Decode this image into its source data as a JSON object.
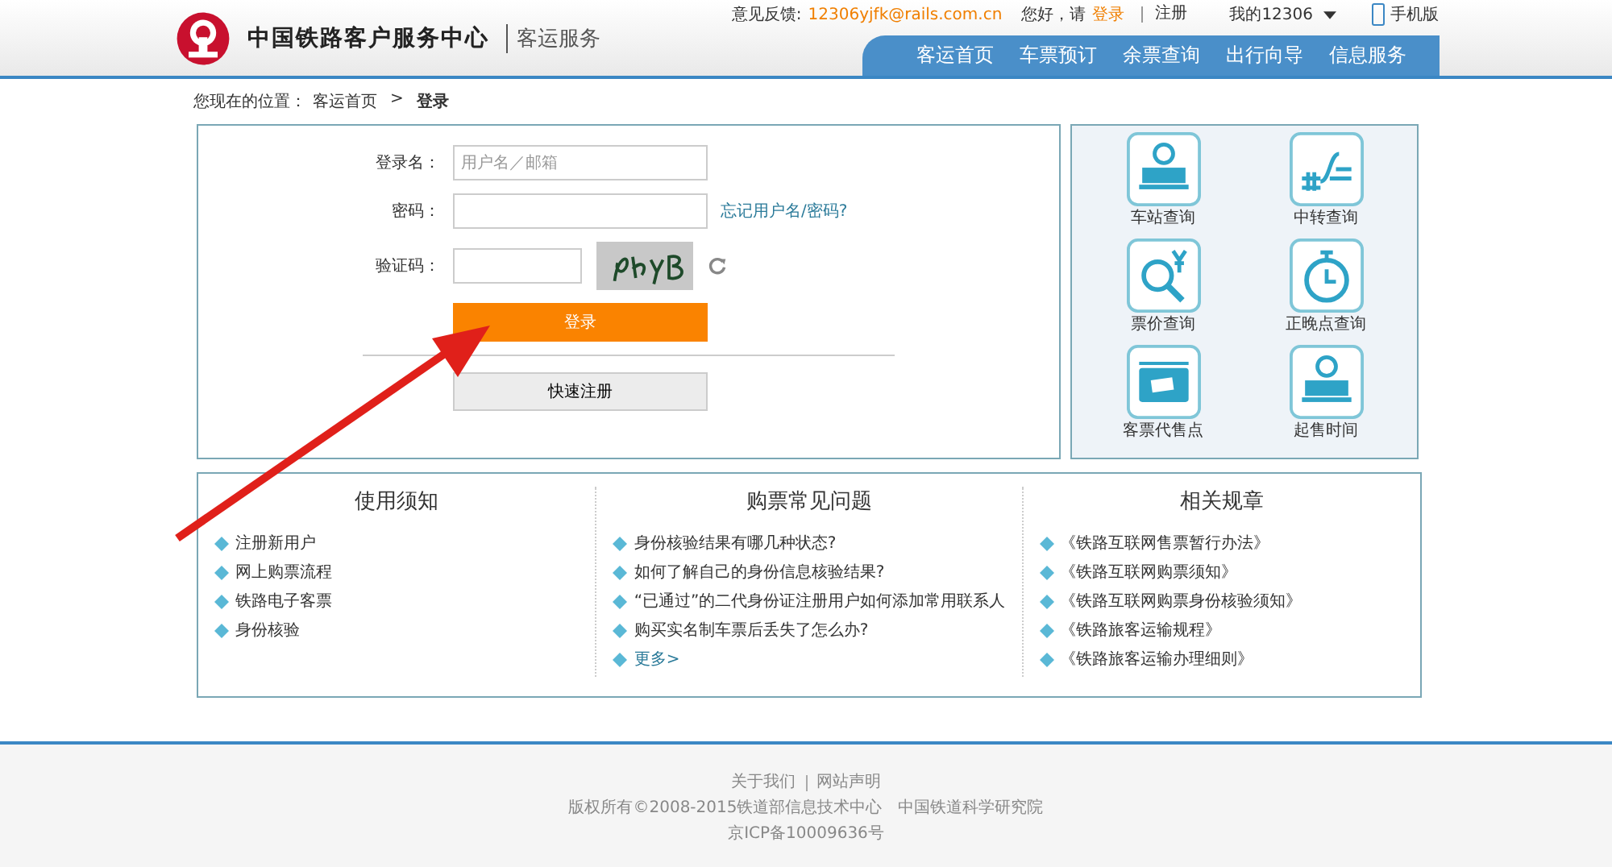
{
  "header": {
    "site_title": "中国铁路客户服务中心",
    "section": "客运服务",
    "feedback_label": "意见反馈:",
    "feedback_email": "12306yjfk@rails.com.cn",
    "greeting": "您好，请",
    "login_link": "登录",
    "register_link": "注册",
    "my_account": "我的12306",
    "mobile": "手机版"
  },
  "nav": [
    {
      "label": "客运首页"
    },
    {
      "label": "车票预订"
    },
    {
      "label": "余票查询"
    },
    {
      "label": "出行向导"
    },
    {
      "label": "信息服务"
    }
  ],
  "breadcrumb": {
    "label": "您现在的位置：",
    "home": "客运首页",
    "separator": ">",
    "current": "登录"
  },
  "login_form": {
    "username_label": "登录名：",
    "username_placeholder": "用户名／邮箱",
    "password_label": "密码：",
    "forgot_link": "忘记用户名/密码?",
    "captcha_label": "验证码：",
    "login_button": "登录",
    "register_button": "快速注册"
  },
  "quick_links": [
    {
      "label": "车站查询",
      "kind": "station"
    },
    {
      "label": "中转查询",
      "kind": "transfer"
    },
    {
      "label": "票价查询",
      "kind": "price"
    },
    {
      "label": "正晚点查询",
      "kind": "clock"
    },
    {
      "label": "客票代售点",
      "kind": "ticket"
    },
    {
      "label": "起售时间",
      "kind": "station"
    }
  ],
  "info_sections": [
    {
      "title": "使用须知",
      "items": [
        "注册新用户",
        "网上购票流程",
        "铁路电子客票",
        "身份核验"
      ]
    },
    {
      "title": "购票常见问题",
      "items": [
        "身份核验结果有哪几种状态?",
        "如何了解自己的身份信息核验结果?",
        "“已通过”的二代身份证注册用户如何添加常用联系人",
        "购买实名制车票后丢失了怎么办?"
      ],
      "more": "更多>"
    },
    {
      "title": "相关规章",
      "items": [
        "《铁路互联网售票暂行办法》",
        "《铁路互联网购票须知》",
        "《铁路互联网购票身份核验须知》",
        "《铁路旅客运输规程》",
        "《铁路旅客运输办理细则》"
      ]
    }
  ],
  "footer": {
    "links": [
      "关于我们",
      "网站声明"
    ],
    "copyright": "版权所有©2008-2015铁道部信息技术中心　中国铁道科学研究院",
    "icp": "京ICP备10009636号"
  }
}
